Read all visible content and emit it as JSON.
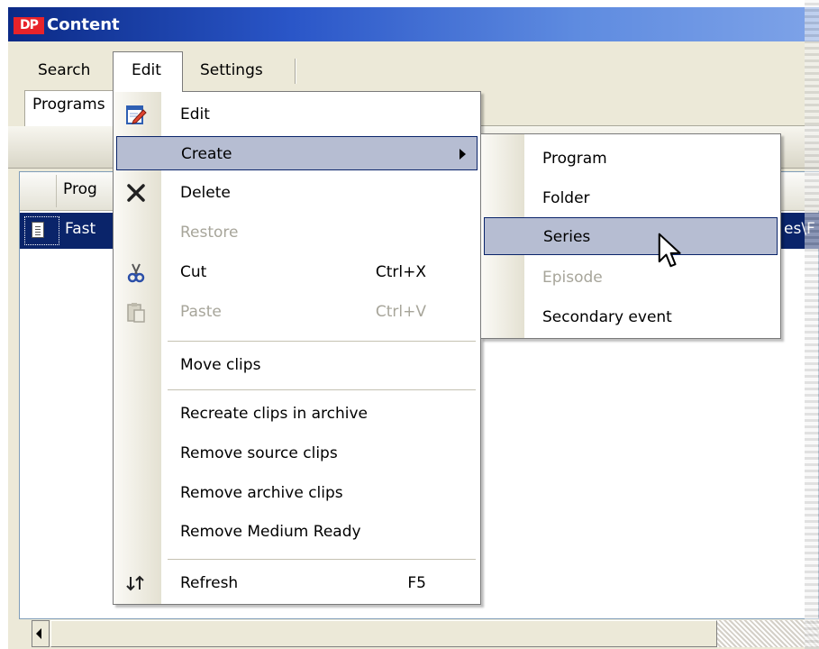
{
  "window": {
    "logo": "DP",
    "title": "Content"
  },
  "menubar": {
    "items": [
      "Search",
      "Edit",
      "Settings"
    ]
  },
  "tabs": [
    "Programs"
  ],
  "grid": {
    "column_header": "Prog",
    "row_left_text": "Fast",
    "row_right_text": "es\\F"
  },
  "edit_menu": {
    "items": [
      {
        "label": "Edit",
        "icon": "edit-icon",
        "enabled": true
      },
      {
        "label": "Create",
        "submenu": true,
        "highlighted": true
      },
      {
        "label": "Delete",
        "icon": "delete-x-icon",
        "enabled": true
      },
      {
        "label": "Restore",
        "enabled": false
      },
      {
        "label": "Cut",
        "shortcut": "Ctrl+X",
        "icon": "scissors-icon",
        "enabled": true
      },
      {
        "label": "Paste",
        "shortcut": "Ctrl+V",
        "icon": "paste-icon",
        "enabled": false
      },
      {
        "label": "Move clips"
      },
      {
        "label": "Recreate clips in archive"
      },
      {
        "label": "Remove source clips"
      },
      {
        "label": "Remove archive clips"
      },
      {
        "label": "Remove Medium Ready"
      },
      {
        "label": "Refresh",
        "shortcut": "F5",
        "icon": "refresh-icon"
      }
    ]
  },
  "create_submenu": {
    "items": [
      {
        "label": "Program",
        "enabled": true
      },
      {
        "label": "Folder",
        "enabled": true
      },
      {
        "label": "Series",
        "enabled": true,
        "highlighted": true
      },
      {
        "label": "Episode",
        "enabled": false
      },
      {
        "label": "Secondary event",
        "enabled": true
      }
    ]
  },
  "colors": {
    "titlebar_start": "#0b2a86",
    "titlebar_end": "#7ea3e8",
    "selection": "#0a246a",
    "menu_highlight": "#b6bdd2",
    "logo_red": "#e8232a"
  }
}
